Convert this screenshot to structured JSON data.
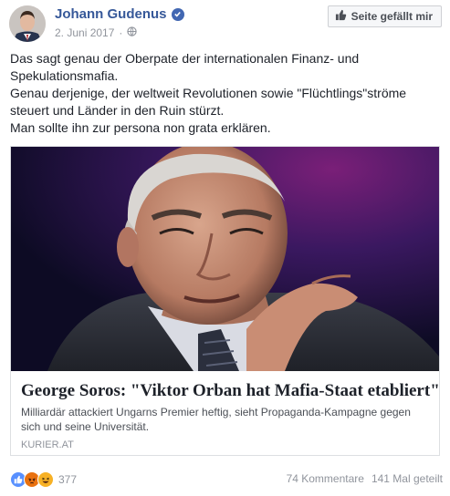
{
  "post": {
    "author": "Johann Gudenus",
    "date": "2. Juni 2017",
    "separator": "·",
    "like_page_label": "Seite gefällt mir",
    "text_lines": [
      "Das sagt genau der Oberpate der internationalen Finanz- und Spekulationsmafia.",
      "Genau derjenige, der weltweit Revolutionen sowie \"Flüchtlings\"ströme steuert und Länder in den Ruin stürzt.",
      "Man sollte ihn zur persona non grata erklären."
    ]
  },
  "link_card": {
    "title": "George Soros: \"Viktor Orban hat Mafia-Staat etabliert\"",
    "description": "Milliardär attackiert Ungarns Premier heftig, sieht Propaganda-Kampagne gegen sich und seine Universität.",
    "source": "KURIER.AT"
  },
  "footer": {
    "reaction_count": "377",
    "reaction_icons": [
      "like-icon",
      "angry-icon",
      "haha-icon"
    ],
    "comments": "74 Kommentare",
    "shares": "141 Mal geteilt"
  },
  "colors": {
    "author_link": "#365899",
    "verified_badge": "#4267b2",
    "meta_gray": "#90949c",
    "like_reaction": "#5890ff",
    "angry_reaction": "#e9710f",
    "haha_reaction": "#f7b125"
  }
}
